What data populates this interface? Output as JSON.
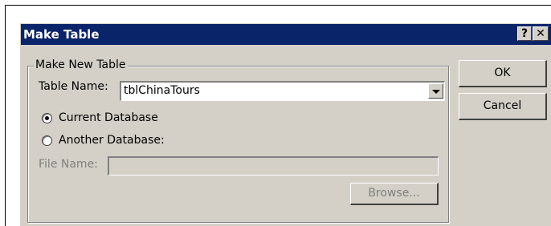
{
  "dialog": {
    "title": "Make Table",
    "help_label": "?",
    "close_label": "✕"
  },
  "group": {
    "legend": "Make New Table",
    "table_name_label": "Table Name:",
    "table_name_value": "tblChinaTours",
    "current_db_label": "Current Database",
    "current_db_checked": true,
    "another_db_label": "Another Database:",
    "another_db_checked": false,
    "file_name_label": "File Name:",
    "file_name_value": "",
    "browse_label": "Browse..."
  },
  "buttons": {
    "ok_label": "OK",
    "cancel_label": "Cancel"
  },
  "icons": {
    "combo_arrow": "chevron-down-icon",
    "radio_checked": "radio-checked-icon",
    "radio_unchecked": "radio-unchecked-icon"
  }
}
